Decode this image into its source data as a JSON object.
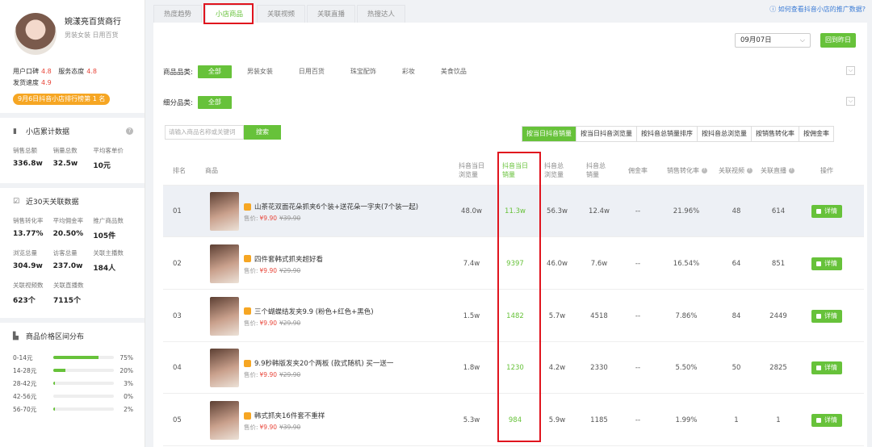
{
  "sidebar": {
    "shop_name": "婉漾亮百货商行",
    "shop_categories": "男装女装 日用百货",
    "ratings": [
      {
        "label": "用户口碑",
        "value": "4.8"
      },
      {
        "label": "服务态度",
        "value": "4.8"
      },
      {
        "label": "发货速度",
        "value": "4.9"
      }
    ],
    "rank_badge": "9月6日抖音小店排行榜第 1 名",
    "cumulative": {
      "title": "小店累计数据",
      "items": [
        {
          "label": "销售总额",
          "value": "336.8w"
        },
        {
          "label": "销量总数",
          "value": "32.5w"
        },
        {
          "label": "平均客单价",
          "value": "10元"
        }
      ]
    },
    "recent30": {
      "title": "近30天关联数据",
      "rows": [
        [
          {
            "label": "销售转化率",
            "value": "13.77%"
          },
          {
            "label": "平均佣金率",
            "value": "20.50%"
          },
          {
            "label": "推广商品数",
            "value": "105件"
          }
        ],
        [
          {
            "label": "浏览总量",
            "value": "304.9w"
          },
          {
            "label": "访客总量",
            "value": "237.0w"
          },
          {
            "label": "关联主播数",
            "value": "184人"
          }
        ],
        [
          {
            "label": "关联视频数",
            "value": "623个"
          },
          {
            "label": "关联直播数",
            "value": "7115个"
          }
        ]
      ]
    },
    "price_dist": {
      "title": "商品价格区间分布",
      "items": [
        {
          "label": "0-14元",
          "pct": "75%",
          "fill": 0.75
        },
        {
          "label": "14-28元",
          "pct": "20%",
          "fill": 0.2
        },
        {
          "label": "28-42元",
          "pct": "3%",
          "fill": 0.03
        },
        {
          "label": "42-56元",
          "pct": "0%",
          "fill": 0.0
        },
        {
          "label": "56-70元",
          "pct": "2%",
          "fill": 0.02
        }
      ]
    }
  },
  "tabs": [
    "热度趋势",
    "小店商品",
    "关联视频",
    "关联直播",
    "热搜达人"
  ],
  "help_link": "如何查看抖音小店的推广数据?",
  "date_value": "09月07日",
  "back_today": "回到昨日",
  "filters": {
    "category_label": "商品品类:",
    "categories": [
      "全部",
      "男装女装",
      "日用百货",
      "珠宝配饰",
      "彩妆",
      "美食饮品"
    ],
    "sub_label": "细分品类:",
    "sub_categories": [
      "全部"
    ]
  },
  "search": {
    "placeholder": "请输入商品名称或关键词",
    "button": "搜索"
  },
  "sort_buttons": [
    "按当日抖音销量",
    "按当日抖音浏览量",
    "按抖音总销量排序",
    "按抖音总浏览量",
    "按销售转化率",
    "按佣金率"
  ],
  "table": {
    "headers": {
      "rank": "排名",
      "product": "商品",
      "day_views": "抖音当日\n浏览量",
      "day_sales": "抖音当日\n销量",
      "total_views": "抖音总\n浏览量",
      "total_sales": "抖音总\n销量",
      "commission": "佣金率",
      "conversion": "销售转化率",
      "videos": "关联视频",
      "lives": "关联直播",
      "action": "操作"
    },
    "price_label": "售价:",
    "detail_label": "详情",
    "rows": [
      {
        "rank": "01",
        "title": "山茶花双面花朵抓夹6个装+送花朵一字夹(7个装一起)",
        "price": "¥9.90",
        "old_price": "¥39.90",
        "day_views": "48.0w",
        "day_sales": "11.3w",
        "total_views": "56.3w",
        "total_sales": "12.4w",
        "commission": "--",
        "conversion": "21.96%",
        "videos": "48",
        "lives": "614"
      },
      {
        "rank": "02",
        "title": "四件套韩式抓夹超好看",
        "price": "¥9.90",
        "old_price": "¥29.90",
        "day_views": "7.4w",
        "day_sales": "9397",
        "total_views": "46.0w",
        "total_sales": "7.6w",
        "commission": "--",
        "conversion": "16.54%",
        "videos": "64",
        "lives": "851"
      },
      {
        "rank": "03",
        "title": "三个蝴蝶结发夹9.9 (粉色+红色+黑色)",
        "price": "¥9.90",
        "old_price": "¥29.90",
        "day_views": "1.5w",
        "day_sales": "1482",
        "total_views": "5.7w",
        "total_sales": "4518",
        "commission": "--",
        "conversion": "7.86%",
        "videos": "84",
        "lives": "2449"
      },
      {
        "rank": "04",
        "title": "9.9秒韩版发夹20个两板 (款式随机) 买一送一",
        "price": "¥9.90",
        "old_price": "¥29.90",
        "day_views": "1.8w",
        "day_sales": "1230",
        "total_views": "4.2w",
        "total_sales": "2330",
        "commission": "--",
        "conversion": "5.50%",
        "videos": "50",
        "lives": "2825"
      },
      {
        "rank": "05",
        "title": "韩式抓夹16件套不重样",
        "price": "¥9.90",
        "old_price": "¥39.90",
        "day_views": "5.3w",
        "day_sales": "984",
        "total_views": "5.9w",
        "total_sales": "1185",
        "commission": "--",
        "conversion": "1.99%",
        "videos": "1",
        "lives": "1"
      }
    ]
  }
}
